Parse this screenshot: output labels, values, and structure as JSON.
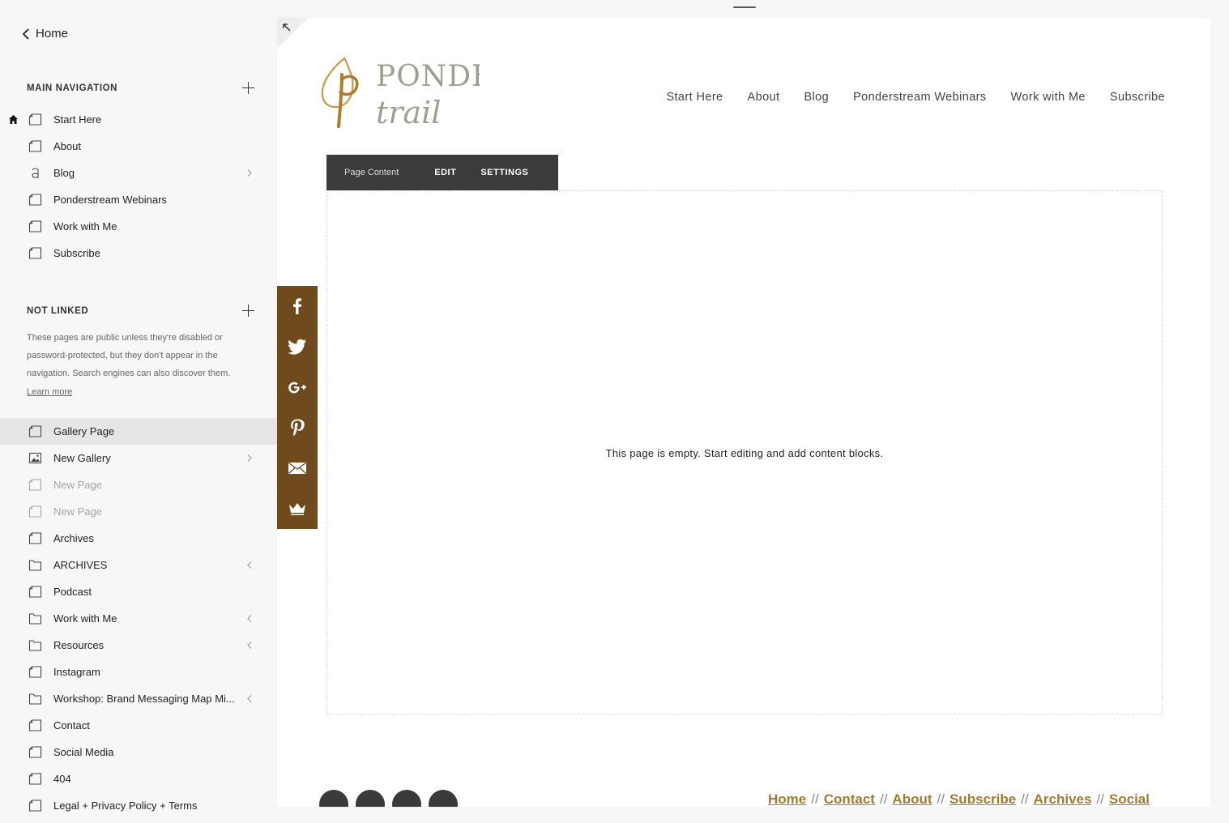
{
  "sidebar": {
    "back_label": "Home",
    "main_nav": {
      "title": "MAIN NAVIGATION",
      "items": [
        {
          "label": "Start Here"
        },
        {
          "label": "About"
        },
        {
          "label": "Blog"
        },
        {
          "label": "Ponderstream Webinars"
        },
        {
          "label": "Work with Me"
        },
        {
          "label": "Subscribe"
        }
      ]
    },
    "not_linked": {
      "title": "NOT LINKED",
      "description": "These pages are public unless they're disabled or password-protected, but they don't appear in the navigation. Search engines can also discover them.",
      "learn_more": "Learn more",
      "items": [
        {
          "label": "Gallery Page"
        },
        {
          "label": "New Gallery"
        },
        {
          "label": "New Page"
        },
        {
          "label": "New Page"
        },
        {
          "label": "Archives"
        },
        {
          "label": "ARCHIVES"
        },
        {
          "label": "Podcast"
        },
        {
          "label": "Work with Me"
        },
        {
          "label": "Resources"
        },
        {
          "label": "Instagram"
        },
        {
          "label": "Workshop: Brand Messaging Map Mi..."
        },
        {
          "label": "Contact"
        },
        {
          "label": "Social Media"
        },
        {
          "label": "404"
        },
        {
          "label": "Legal + Privacy Policy + Terms"
        }
      ]
    }
  },
  "site": {
    "logo_line1": "PONDER",
    "logo_line2": "trail",
    "nav": [
      "Start Here",
      "About",
      "Blog",
      "Ponderstream Webinars",
      "Work with Me",
      "Subscribe"
    ],
    "content_tabs": {
      "label": "Page Content",
      "edit": "EDIT",
      "settings": "SETTINGS"
    },
    "empty_message": "This page is empty. Start editing and add content blocks.",
    "footer_links": [
      "Home",
      "Contact",
      "About",
      "Subscribe",
      "Archives",
      "Social"
    ],
    "footer_sep": "//"
  },
  "colors": {
    "brand_brown": "#6e4a1d",
    "footer_gold": "#a57a2e",
    "selected_row": "#e6e6e6"
  }
}
